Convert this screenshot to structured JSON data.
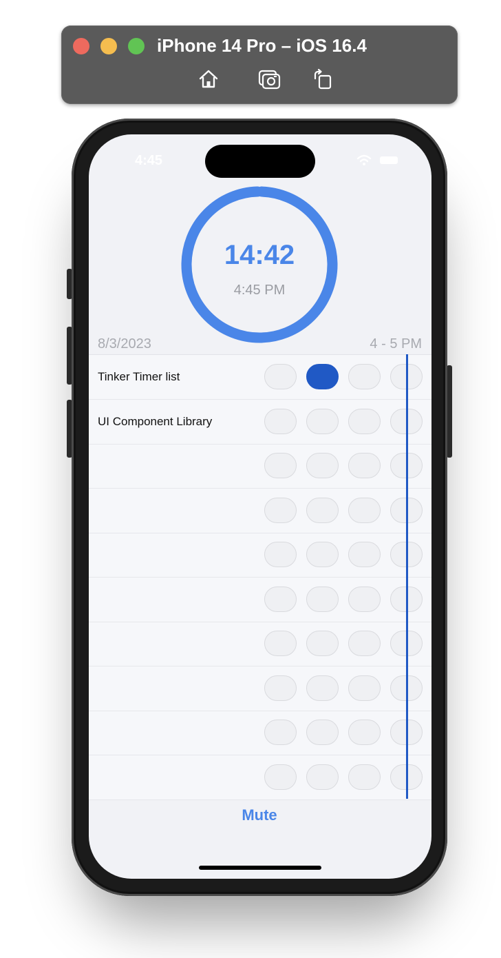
{
  "simulator": {
    "title": "iPhone 14 Pro – iOS 16.4",
    "buttons": {
      "home": "home-icon",
      "screenshot": "camera-icon",
      "rotate": "rotate-icon"
    }
  },
  "status_bar": {
    "time": "4:45"
  },
  "timer": {
    "remaining": "14:42",
    "current_time": "4:45 PM",
    "progress": 0.99,
    "ring_color": "#4a86e8"
  },
  "schedule": {
    "date": "8/3/2023",
    "hour_range": "4 - 5 PM",
    "rows": [
      {
        "label": "Tinker Timer list",
        "active_slot": 1
      },
      {
        "label": "UI Component Library",
        "active_slot": -1
      },
      {
        "label": "",
        "active_slot": -1
      },
      {
        "label": "",
        "active_slot": -1
      },
      {
        "label": "",
        "active_slot": -1
      },
      {
        "label": "",
        "active_slot": -1
      },
      {
        "label": "",
        "active_slot": -1
      },
      {
        "label": "",
        "active_slot": -1
      },
      {
        "label": "",
        "active_slot": -1
      },
      {
        "label": "",
        "active_slot": -1
      }
    ],
    "slots_per_row": 4,
    "active_color": "#2059c5"
  },
  "footer": {
    "mute_label": "Mute"
  }
}
